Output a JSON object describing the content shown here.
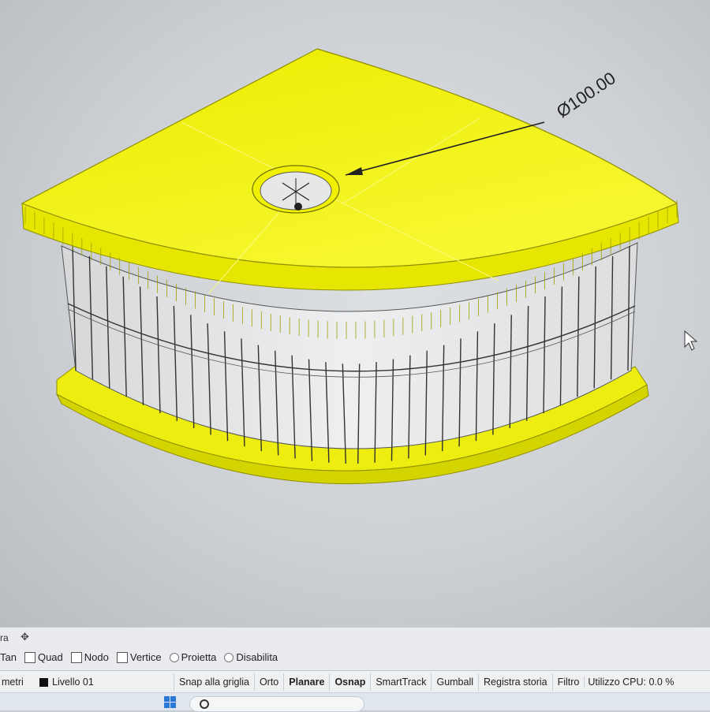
{
  "viewport": {
    "dimension_label": "Ø100.00"
  },
  "osnap": {
    "tab_label": "ra",
    "tab_add_icon": "plus-icon",
    "items": [
      {
        "label": "Tan",
        "type": "checkbox",
        "checked": false
      },
      {
        "label": "Quad",
        "type": "checkbox",
        "checked": false
      },
      {
        "label": "Nodo",
        "type": "checkbox",
        "checked": false
      },
      {
        "label": "Vertice",
        "type": "checkbox",
        "checked": false
      },
      {
        "label": "Proietta",
        "type": "radio",
        "checked": false
      },
      {
        "label": "Disabilita",
        "type": "radio",
        "checked": false
      }
    ]
  },
  "status": {
    "units": "metri",
    "layer": "Livello 01",
    "layer_color": "#111111",
    "buttons": [
      {
        "label": "Snap alla griglia",
        "active": false
      },
      {
        "label": "Orto",
        "active": false
      },
      {
        "label": "Planare",
        "active": true
      },
      {
        "label": "Osnap",
        "active": true
      },
      {
        "label": "SmartTrack",
        "active": false
      },
      {
        "label": "Gumball",
        "active": false
      },
      {
        "label": "Registra storia",
        "active": false
      },
      {
        "label": "Filtro",
        "active": false
      }
    ],
    "cpu": "Utilizzo CPU: 0.0 %"
  },
  "colors": {
    "model_yellow": "#f2f200",
    "model_edge": "#8f8f00",
    "panel_grey": "#e4e5e6"
  }
}
